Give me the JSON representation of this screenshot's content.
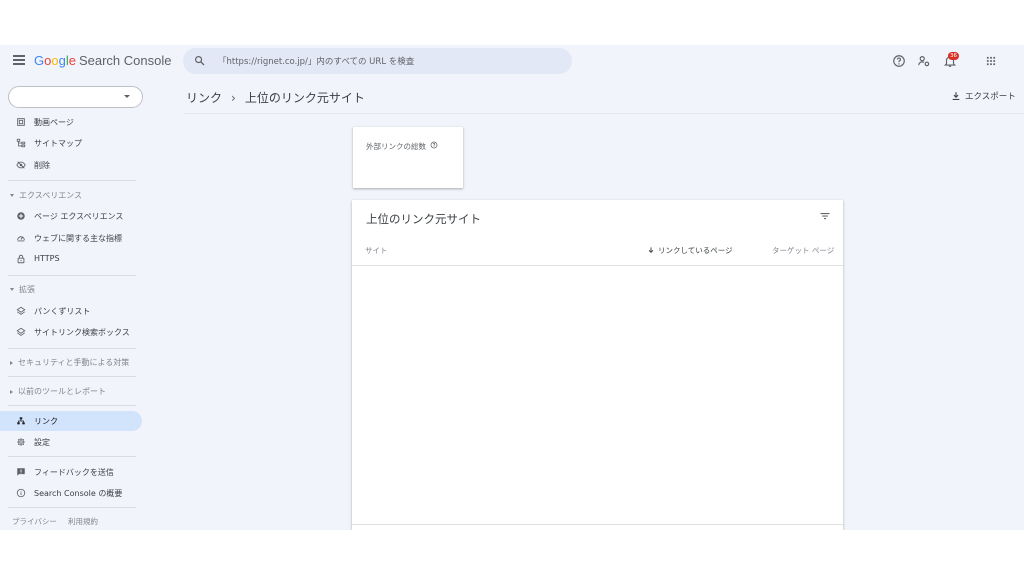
{
  "header": {
    "logo": {
      "letters": [
        "G",
        "o",
        "o",
        "g",
        "l",
        "e"
      ],
      "product": "Search Console"
    },
    "search": {
      "placeholder": "「https://rignet.co.jp/」内のすべての URL を検査"
    },
    "notification_count": "36"
  },
  "sidebar": {
    "property_value": "",
    "items_top": [
      {
        "label": "動画ページ",
        "icon": "video-pages-icon"
      },
      {
        "label": "サイトマップ",
        "icon": "sitemap-icon"
      },
      {
        "label": "削除",
        "icon": "removals-icon"
      }
    ],
    "experience": {
      "label": "エクスペリエンス",
      "items": [
        {
          "label": "ページ エクスペリエンス",
          "icon": "page-experience-icon"
        },
        {
          "label": "ウェブに関する主な指標",
          "icon": "core-web-vitals-icon"
        },
        {
          "label": "HTTPS",
          "icon": "lock-icon"
        }
      ]
    },
    "enhancements": {
      "label": "拡張",
      "items": [
        {
          "label": "パンくずリスト",
          "icon": "layers-icon"
        },
        {
          "label": "サイトリンク検索ボックス",
          "icon": "layers-icon"
        }
      ]
    },
    "security_label": "セキュリティと手動による対策",
    "legacy_label": "以前のツールとレポート",
    "links_label": "リンク",
    "settings_label": "設定",
    "feedback_label": "フィードバックを送信",
    "about_label": "Search Console の概要",
    "footer": {
      "privacy": "プライバシー",
      "terms": "利用規約"
    }
  },
  "main": {
    "breadcrumb": {
      "parent": "リンク",
      "separator": "›",
      "current": "上位のリンク元サイト"
    },
    "export_label": "エクスポート",
    "metric_card": {
      "label": "外部リンクの総数"
    },
    "table": {
      "title": "上位のリンク元サイト",
      "columns": {
        "site": "サイト",
        "linking_pages": "リンクしているページ",
        "target_pages": "ターゲット ページ"
      }
    }
  }
}
